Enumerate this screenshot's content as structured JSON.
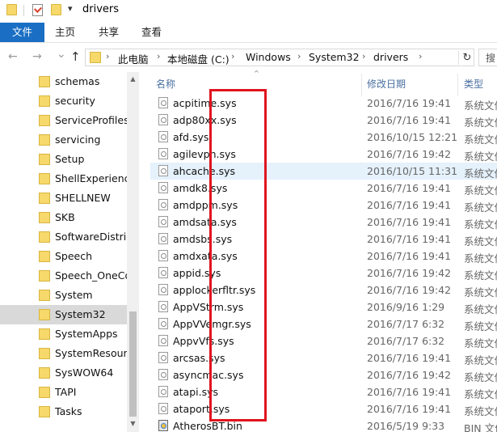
{
  "window": {
    "title": "drivers",
    "quick_access_arrow": "▾"
  },
  "ribbon": {
    "file_tab": "文件",
    "tabs": [
      "主页",
      "共享",
      "查看"
    ]
  },
  "address": {
    "back": "←",
    "forward": "→",
    "dropdown": "⌄",
    "up": "↑",
    "crumbs": [
      "此电脑",
      "本地磁盘 (C:)",
      "Windows",
      "System32",
      "drivers"
    ],
    "separator": "›",
    "refresh": "↻",
    "search_placeholder": "搜"
  },
  "nav_pane": {
    "items": [
      "schemas",
      "security",
      "ServiceProfiles",
      "servicing",
      "Setup",
      "ShellExperiences",
      "SHELLNEW",
      "SKB",
      "SoftwareDistribution",
      "Speech",
      "Speech_OneCore",
      "System",
      "System32",
      "SystemApps",
      "SystemResources",
      "SysWOW64",
      "TAPI",
      "Tasks"
    ],
    "selected": "System32"
  },
  "file_list": {
    "sort_indicator": "^",
    "columns": {
      "name": "名称",
      "date": "修改日期",
      "type": "类型"
    },
    "rows": [
      {
        "name": "acpitime.sys",
        "date": "2016/7/16 19:41",
        "type": "系统文件"
      },
      {
        "name": "adp80xx.sys",
        "date": "2016/7/16 19:41",
        "type": "系统文件"
      },
      {
        "name": "afd.sys",
        "date": "2016/10/15 12:21",
        "type": "系统文件"
      },
      {
        "name": "agilevpn.sys",
        "date": "2016/7/16 19:42",
        "type": "系统文件"
      },
      {
        "name": "ahcache.sys",
        "date": "2016/10/15 11:31",
        "type": "系统文件"
      },
      {
        "name": "amdk8.sys",
        "date": "2016/7/16 19:41",
        "type": "系统文件"
      },
      {
        "name": "amdppm.sys",
        "date": "2016/7/16 19:41",
        "type": "系统文件"
      },
      {
        "name": "amdsata.sys",
        "date": "2016/7/16 19:41",
        "type": "系统文件"
      },
      {
        "name": "amdsbs.sys",
        "date": "2016/7/16 19:41",
        "type": "系统文件"
      },
      {
        "name": "amdxata.sys",
        "date": "2016/7/16 19:41",
        "type": "系统文件"
      },
      {
        "name": "appid.sys",
        "date": "2016/7/16 19:42",
        "type": "系统文件"
      },
      {
        "name": "applockerfltr.sys",
        "date": "2016/7/16 19:42",
        "type": "系统文件"
      },
      {
        "name": "AppVStrm.sys",
        "date": "2016/9/16 1:29",
        "type": "系统文件"
      },
      {
        "name": "AppVVemgr.sys",
        "date": "2016/7/17 6:32",
        "type": "系统文件"
      },
      {
        "name": "AppvVfs.sys",
        "date": "2016/7/17 6:32",
        "type": "系统文件"
      },
      {
        "name": "arcsas.sys",
        "date": "2016/7/16 19:41",
        "type": "系统文件"
      },
      {
        "name": "asyncmac.sys",
        "date": "2016/7/16 19:42",
        "type": "系统文件"
      },
      {
        "name": "atapi.sys",
        "date": "2016/7/16 19:41",
        "type": "系统文件"
      },
      {
        "name": "ataport.sys",
        "date": "2016/7/16 19:41",
        "type": "系统文件"
      },
      {
        "name": "AtherosBT.bin",
        "date": "2016/5/19 9:33",
        "type": "BIN 文件"
      }
    ],
    "hovered": "ahcache.sys"
  },
  "colors": {
    "accent": "#1a6fc4",
    "highlight_box": "#e0141e",
    "selected_bg": "#d9d9d9",
    "hover_bg": "#e5f1fb"
  }
}
